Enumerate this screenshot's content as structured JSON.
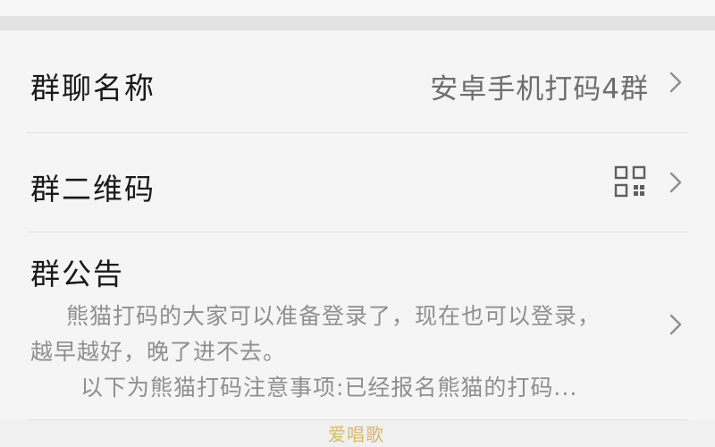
{
  "settings": {
    "group_name": {
      "label": "群聊名称",
      "value": "安卓手机打码4群",
      "icon": "chevron-right-icon"
    },
    "group_qr": {
      "label": "群二维码",
      "icon": "qr-code-icon",
      "chevron_icon": "chevron-right-icon"
    },
    "group_notice": {
      "label": "群公告",
      "lines": [
        "熊猫打码的大家可以准备登录了，现在也可以登录，",
        "越早越好，晚了进不去。",
        "以下为熊猫打码注意事项:已经报名熊猫的打码..."
      ],
      "icon": "chevron-right-icon"
    }
  },
  "watermark": "爱唱歌"
}
